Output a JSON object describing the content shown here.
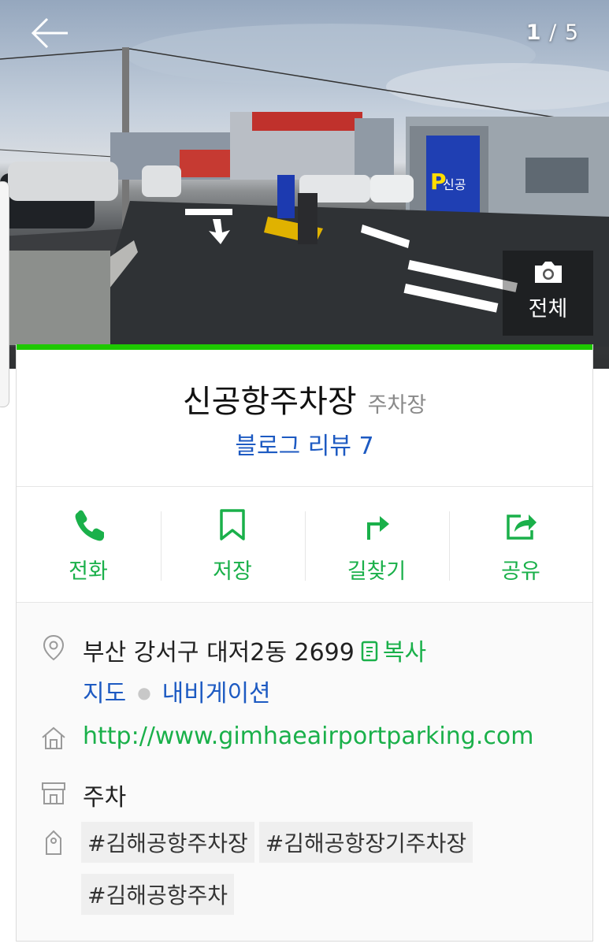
{
  "header": {
    "photo_current": "1",
    "photo_separator": "/",
    "photo_total": "5",
    "all_photos_label": "전체"
  },
  "place": {
    "name": "신공항주차장",
    "category": "주차장",
    "reviews_label": "블로그 리뷰 7"
  },
  "actions": [
    {
      "label": "전화",
      "icon": "phone-icon"
    },
    {
      "label": "저장",
      "icon": "bookmark-icon"
    },
    {
      "label": "길찾기",
      "icon": "directions-icon"
    },
    {
      "label": "공유",
      "icon": "share-icon"
    }
  ],
  "info": {
    "address": "부산 강서구 대저2동 2699",
    "copy_label": "복사",
    "map_label": "지도",
    "navigation_label": "내비게이션",
    "website": "http://www.gimhaeairportparking.com",
    "business_type": "주차",
    "tags": [
      "#김해공항주차장",
      "#김해공항장기주차장",
      "#김해공항주차"
    ]
  },
  "colors": {
    "accent_green": "#1ec800",
    "link_green": "#1ab04a",
    "link_blue": "#1d5ac2"
  }
}
